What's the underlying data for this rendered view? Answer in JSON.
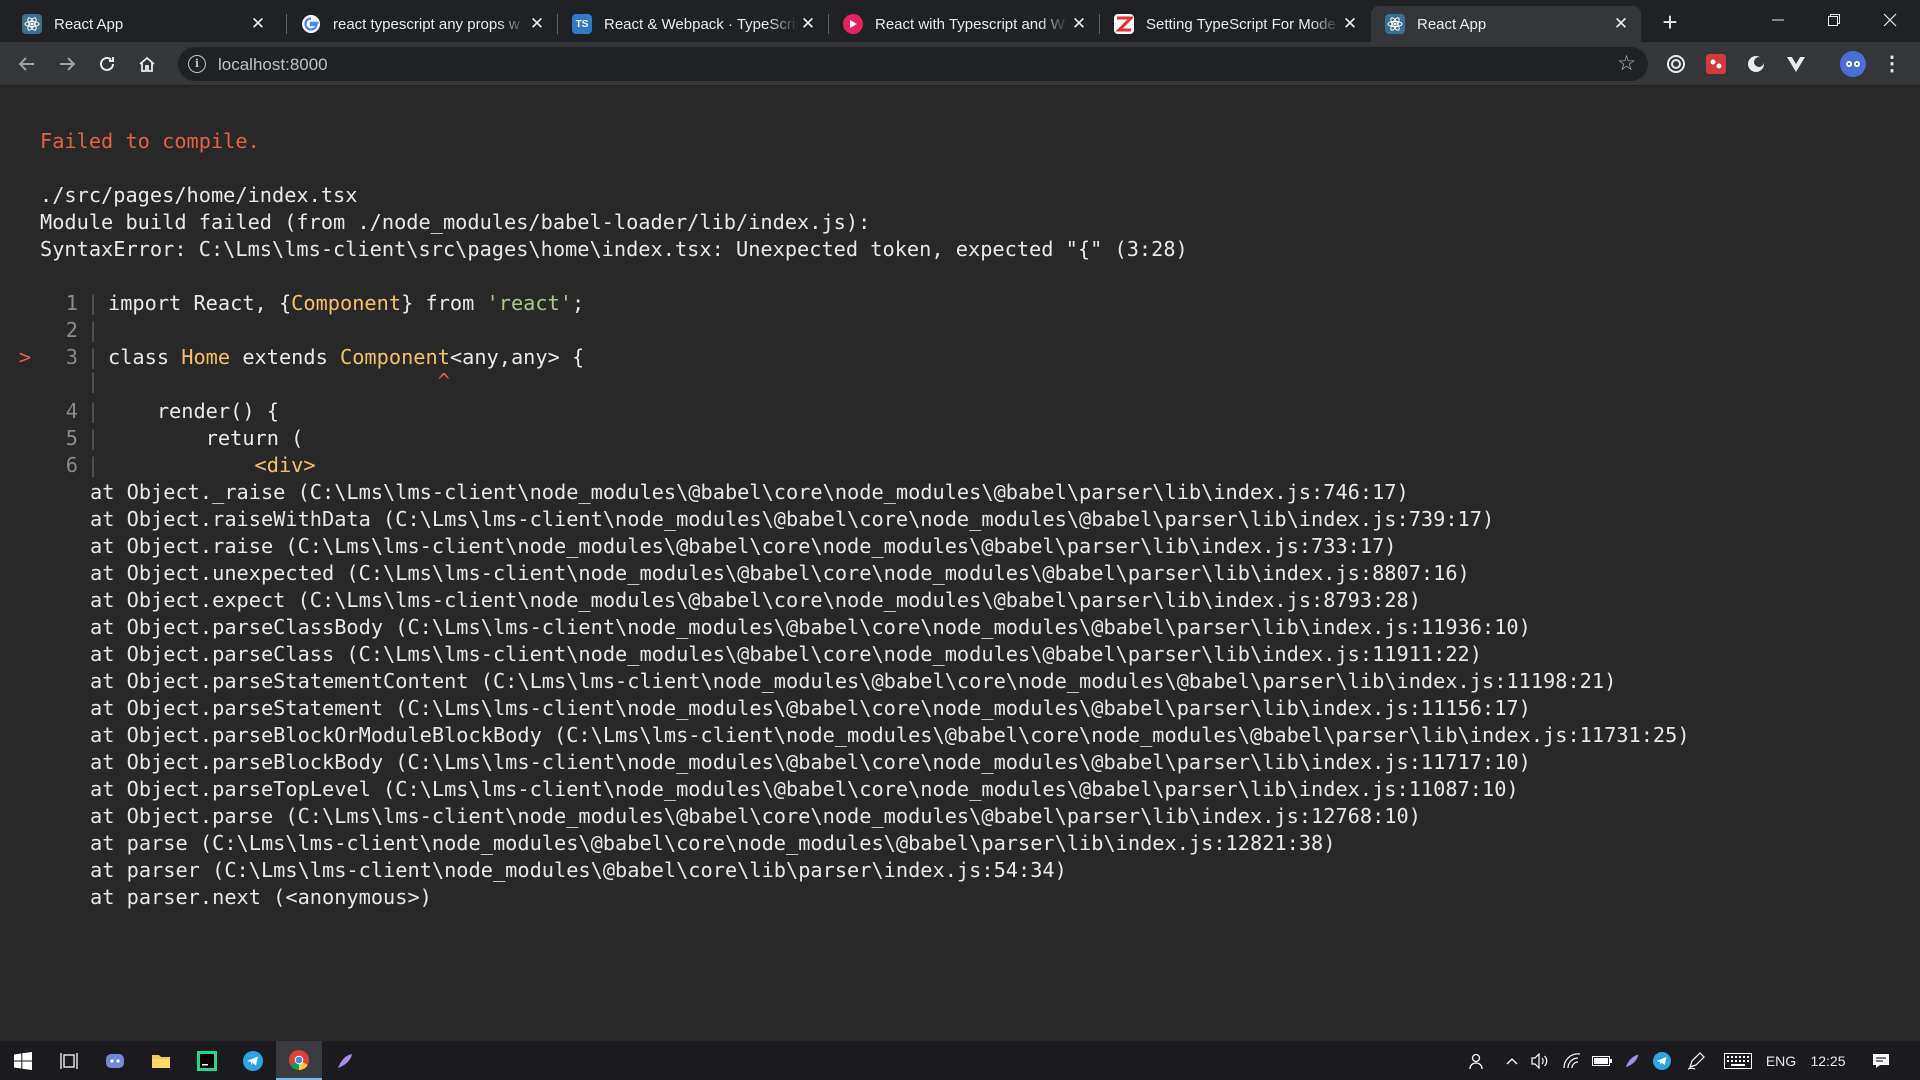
{
  "tabs": [
    {
      "title": "React App",
      "favicon": "react-icon",
      "color": "#61dafb"
    },
    {
      "title": "react typescript any props w",
      "favicon": "google-icon",
      "color": "#ffffff"
    },
    {
      "title": "React & Webpack · TypeScrip",
      "favicon": "ts-icon",
      "color": "#3178c6",
      "favicon_text": "TS"
    },
    {
      "title": "React with Typescript and W",
      "favicon": "play-icon",
      "color": "#e5225e"
    },
    {
      "title": "Setting TypeScript For Mode",
      "favicon": "site-icon",
      "color": "#e62e2e"
    },
    {
      "title": "React App",
      "favicon": "react-icon",
      "color": "#61dafb"
    }
  ],
  "address": {
    "url": "localhost:8000"
  },
  "error": {
    "title": "Failed to compile.",
    "file": "./src/pages/home/index.tsx",
    "module_line": "Module build failed (from ./node_modules/babel-loader/lib/index.js):",
    "syntax_line": "SyntaxError: C:\\Lms\\lms-client\\src\\pages\\home\\index.tsx: Unexpected token, expected \"{\" (3:28)"
  },
  "code": {
    "l1_num": "1",
    "l1_a": "import React, {",
    "l1_b": "Component",
    "l1_c": "} from ",
    "l1_d": "'react'",
    "l1_e": ";",
    "l2_num": "2",
    "l3_marker": ">",
    "l3_num": "3",
    "l3_a": "class ",
    "l3_b": "Home",
    "l3_c": " extends ",
    "l3_d": "Component",
    "l3_e": "<any,any> {",
    "caret": "^",
    "l4_num": "4",
    "l4": "    render() {",
    "l5_num": "5",
    "l5": "        return (",
    "l6_num": "6",
    "l6": "            <div>"
  },
  "stack": [
    "at Object._raise (C:\\Lms\\lms-client\\node_modules\\@babel\\core\\node_modules\\@babel\\parser\\lib\\index.js:746:17)",
    "at Object.raiseWithData (C:\\Lms\\lms-client\\node_modules\\@babel\\core\\node_modules\\@babel\\parser\\lib\\index.js:739:17)",
    "at Object.raise (C:\\Lms\\lms-client\\node_modules\\@babel\\core\\node_modules\\@babel\\parser\\lib\\index.js:733:17)",
    "at Object.unexpected (C:\\Lms\\lms-client\\node_modules\\@babel\\core\\node_modules\\@babel\\parser\\lib\\index.js:8807:16)",
    "at Object.expect (C:\\Lms\\lms-client\\node_modules\\@babel\\core\\node_modules\\@babel\\parser\\lib\\index.js:8793:28)",
    "at Object.parseClassBody (C:\\Lms\\lms-client\\node_modules\\@babel\\core\\node_modules\\@babel\\parser\\lib\\index.js:11936:10)",
    "at Object.parseClass (C:\\Lms\\lms-client\\node_modules\\@babel\\core\\node_modules\\@babel\\parser\\lib\\index.js:11911:22)",
    "at Object.parseStatementContent (C:\\Lms\\lms-client\\node_modules\\@babel\\core\\node_modules\\@babel\\parser\\lib\\index.js:11198:21)",
    "at Object.parseStatement (C:\\Lms\\lms-client\\node_modules\\@babel\\core\\node_modules\\@babel\\parser\\lib\\index.js:11156:17)",
    "at Object.parseBlockOrModuleBlockBody (C:\\Lms\\lms-client\\node_modules\\@babel\\core\\node_modules\\@babel\\parser\\lib\\index.js:11731:25)",
    "at Object.parseBlockBody (C:\\Lms\\lms-client\\node_modules\\@babel\\core\\node_modules\\@babel\\parser\\lib\\index.js:11717:10)",
    "at Object.parseTopLevel (C:\\Lms\\lms-client\\node_modules\\@babel\\core\\node_modules\\@babel\\parser\\lib\\index.js:11087:10)",
    "at Object.parse (C:\\Lms\\lms-client\\node_modules\\@babel\\core\\node_modules\\@babel\\parser\\lib\\index.js:12768:10)",
    "at parse (C:\\Lms\\lms-client\\node_modules\\@babel\\core\\node_modules\\@babel\\parser\\lib\\index.js:12821:38)",
    "at parser (C:\\Lms\\lms-client\\node_modules\\@babel\\core\\lib\\parser\\index.js:54:34)",
    "at parser.next (<anonymous>)"
  ],
  "taskbar": {
    "lang": "ENG",
    "time": "12:25"
  },
  "colors": {
    "error_red": "#e36049",
    "string_green": "#a8c98a",
    "highlight_yellow": "#f5c066",
    "background": "#282828"
  }
}
